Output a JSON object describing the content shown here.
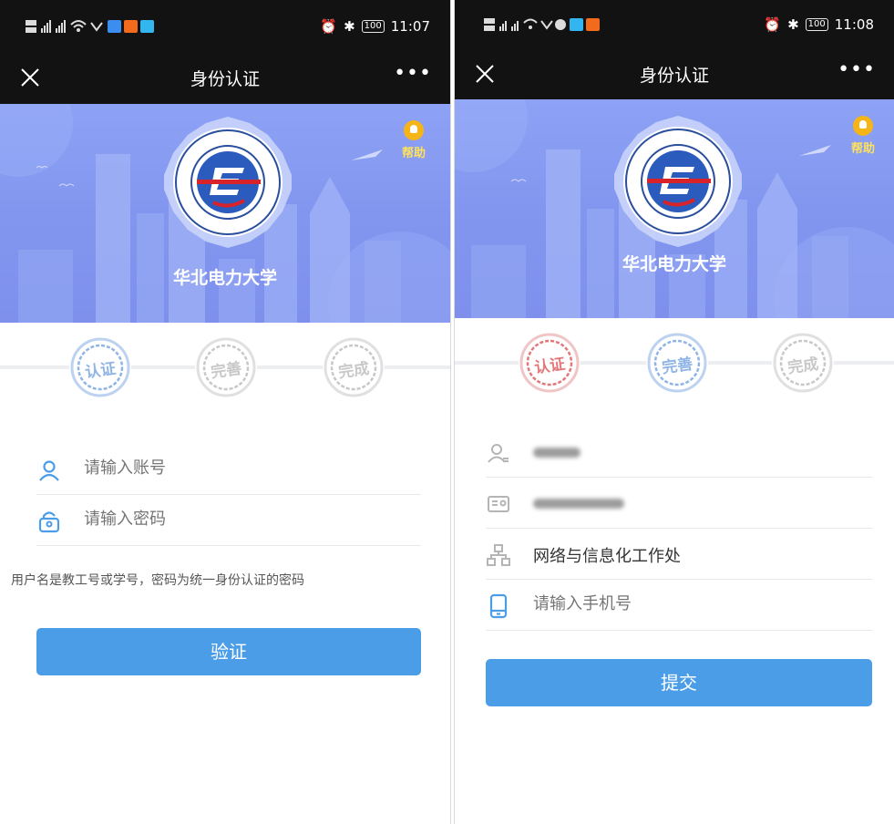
{
  "left_screen": {
    "status": {
      "icons": "NBD# ¹ᵈ⸋⸋ ⸋⸋",
      "time": "11:07",
      "battery": "100"
    },
    "title": "身份认证",
    "help_label": "帮助",
    "university_name": "华北电力大学",
    "steps": [
      {
        "label": "认证",
        "state": "active"
      },
      {
        "label": "完善",
        "state": "inactive"
      },
      {
        "label": "完成",
        "state": "inactive"
      }
    ],
    "form": {
      "account_placeholder": "请输入账号",
      "password_placeholder": "请输入密码",
      "hint": "用户名是教工号或学号，密码为统一身份认证的密码",
      "submit_label": "验证"
    }
  },
  "right_screen": {
    "status": {
      "time": "11:08",
      "battery": "100"
    },
    "title": "身份认证",
    "help_label": "帮助",
    "university_name": "华北电力大学",
    "steps": [
      {
        "label": "认证",
        "state": "done"
      },
      {
        "label": "完善",
        "state": "active"
      },
      {
        "label": "完成",
        "state": "inactive"
      }
    ],
    "form": {
      "department_value": "网络与信息化工作处",
      "phone_placeholder": "请输入手机号",
      "submit_label": "提交"
    }
  },
  "colors": {
    "accent": "#4b9de8",
    "step_active": "#8fb4e6",
    "step_done": "#e2787a",
    "step_inactive": "#c8c8c8",
    "banner": "#8296ef",
    "help": "#f6b517"
  },
  "icons": [
    "close-icon",
    "more-icon",
    "help-icon",
    "user-icon",
    "lock-icon",
    "id-card-icon",
    "org-icon",
    "phone-icon"
  ]
}
